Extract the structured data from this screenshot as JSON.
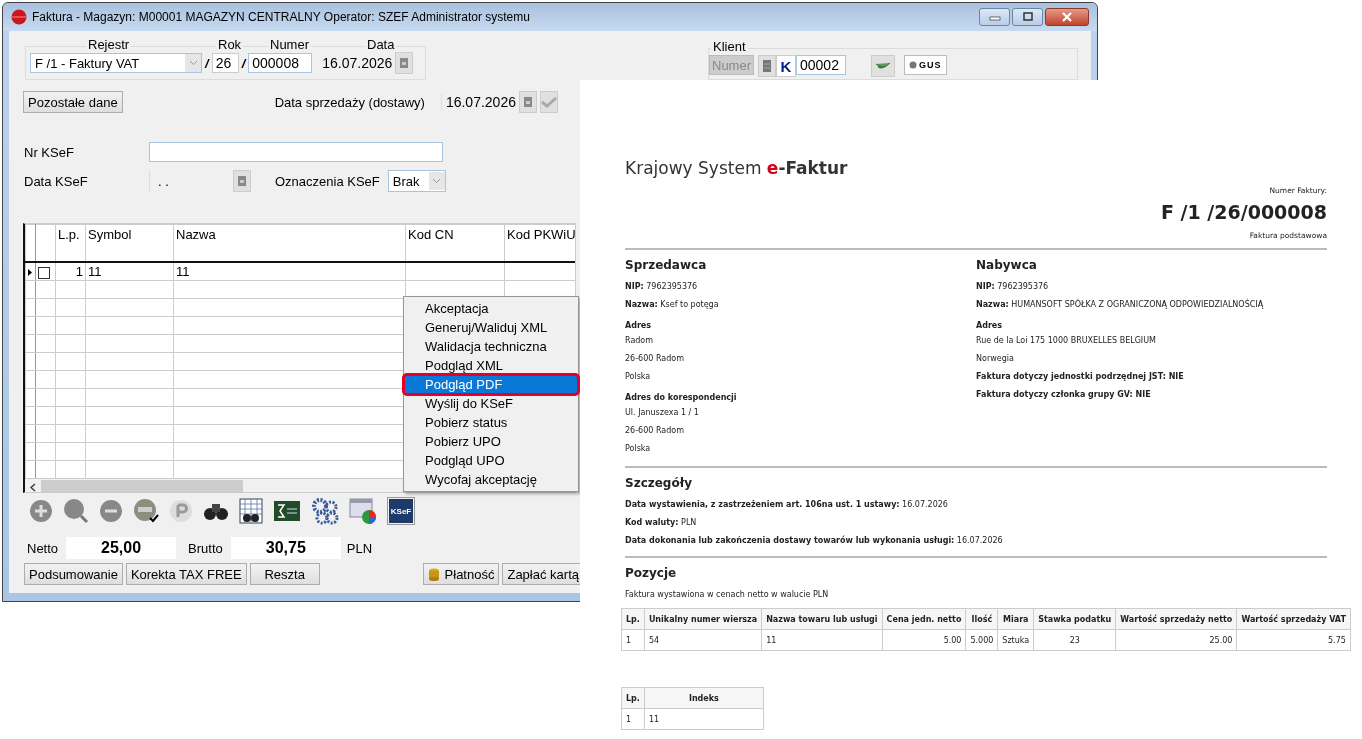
{
  "window": {
    "title": "Faktura - Magazyn: M00001 MAGAZYN CENTRALNY  Operator: SZEF Administrator systemu"
  },
  "header": {
    "rejestr_label": "Rejestr",
    "rejestr_value": "F /1   - Faktury VAT",
    "separator": "/",
    "rok_label": "Rok",
    "rok_value": "26",
    "numer_label": "Numer",
    "numer_value": "000008",
    "data_label": "Data",
    "data_value": "16.07.2026"
  },
  "klient": {
    "label": "Klient",
    "numer_button": "Numer",
    "k_label": "K",
    "value": "00002",
    "gus_label": "GUS"
  },
  "other_data_button": "Pozostałe dane",
  "sale_date": {
    "label": "Data sprzedaży (dostawy)",
    "value": "16.07.2026"
  },
  "ksef": {
    "nr_label": "Nr KSeF",
    "date_label": "Data KSeF",
    "date_value": ". .",
    "marks_label": "Oznaczenia KSeF",
    "marks_value": "Brak"
  },
  "grid": {
    "columns": [
      "L.p.",
      "Symbol",
      "Nazwa",
      "Kod  CN",
      "Kod  PKWiU"
    ],
    "rows": [
      {
        "current": true,
        "checked": false,
        "cells": [
          "1",
          "11",
          "11"
        ]
      }
    ]
  },
  "context_menu": [
    {
      "label": "Akceptacja",
      "selected": false
    },
    {
      "label": "Generuj/Waliduj XML",
      "selected": false
    },
    {
      "label": "Walidacja techniczna",
      "selected": false
    },
    {
      "label": "Podgląd XML",
      "selected": false
    },
    {
      "label": "Podgląd PDF",
      "selected": true
    },
    {
      "label": "Wyślij do KSeF",
      "selected": false
    },
    {
      "label": "Pobierz status",
      "selected": false
    },
    {
      "label": "Pobierz UPO",
      "selected": false
    },
    {
      "label": "Podgląd UPO",
      "selected": false
    },
    {
      "label": "Wycofaj akceptację",
      "selected": false
    }
  ],
  "toolbar": {
    "ksef_label": "KSeF"
  },
  "totals": {
    "netto_label": "Netto",
    "netto_value": "25,00",
    "brutto_label": "Brutto",
    "brutto_value": "30,75",
    "currency": "PLN"
  },
  "buttons_left": [
    "Podsumowanie",
    "Korekta TAX FREE",
    "Reszta"
  ],
  "buttons_right": [
    {
      "kind": "payment",
      "label": "Płatność"
    },
    {
      "kind": "plain",
      "label": "Zapłać kartą"
    }
  ],
  "pdf": {
    "brand_prefix": "Krajowy System",
    "brand_accent": "e",
    "brand_suffix": "-Faktur",
    "number_label": "Numer Faktury:",
    "number": "F /1  /26/000008",
    "type": "Faktura podstawowa",
    "seller": {
      "heading": "Sprzedawca",
      "fields": [
        {
          "label": "NIP:",
          "value": "7962395376"
        },
        {
          "label": "Nazwa:",
          "value": "Ksef to potęga"
        }
      ],
      "sections": [
        {
          "heading": "Adres",
          "lines": [
            "Radom",
            "26-600 Radom",
            "Polska"
          ]
        },
        {
          "heading": "Adres do korespondencji",
          "lines": [
            "Ul. Januszexa 1 / 1",
            "26-600 Radom",
            "Polska"
          ]
        }
      ]
    },
    "buyer": {
      "heading": "Nabywca",
      "fields": [
        {
          "label": "NIP:",
          "value": "7962395376"
        },
        {
          "label": "Nazwa:",
          "value": "HUMANSOFT SPÓŁKA Z OGRANICZONĄ ODPOWIEDZIALNOŚCIĄ"
        }
      ],
      "sections": [
        {
          "heading": "Adres",
          "lines": [
            "Rue de la Loi 175 1000 BRUXELLES BELGIUM",
            "Norwegia"
          ]
        }
      ],
      "flags": [
        "Faktura dotyczy jednostki podrzędnej JST: NIE",
        "Faktura dotyczy członka grupy GV: NIE"
      ]
    },
    "details": {
      "heading": "Szczegóły",
      "fields": [
        {
          "label": "Data wystawienia, z zastrzeżeniem art. 106na ust. 1 ustawy:",
          "value": "16.07.2026"
        },
        {
          "label": "Kod waluty:",
          "value": "PLN"
        },
        {
          "label": "Data dokonania lub zakończenia dostawy towarów lub wykonania usługi:",
          "value": "16.07.2026"
        }
      ]
    },
    "items": {
      "heading": "Pozycje",
      "note": "Faktura wystawiona w cenach netto w walucie PLN",
      "columns": [
        "Lp.",
        "Unikalny numer wiersza",
        "Nazwa towaru lub usługi",
        "Cena jedn. netto",
        "Ilość",
        "Miara",
        "Stawka podatku",
        "Wartość sprzedaży netto",
        "Wartość sprzedaży VAT"
      ],
      "rows": [
        [
          "1",
          "54",
          "11",
          "5.00",
          "5.000",
          "Sztuka",
          "23",
          "25.00",
          "5.75"
        ]
      ]
    },
    "index_table": {
      "columns": [
        "Lp.",
        "Indeks"
      ],
      "rows": [
        [
          "1",
          "11"
        ]
      ]
    }
  }
}
